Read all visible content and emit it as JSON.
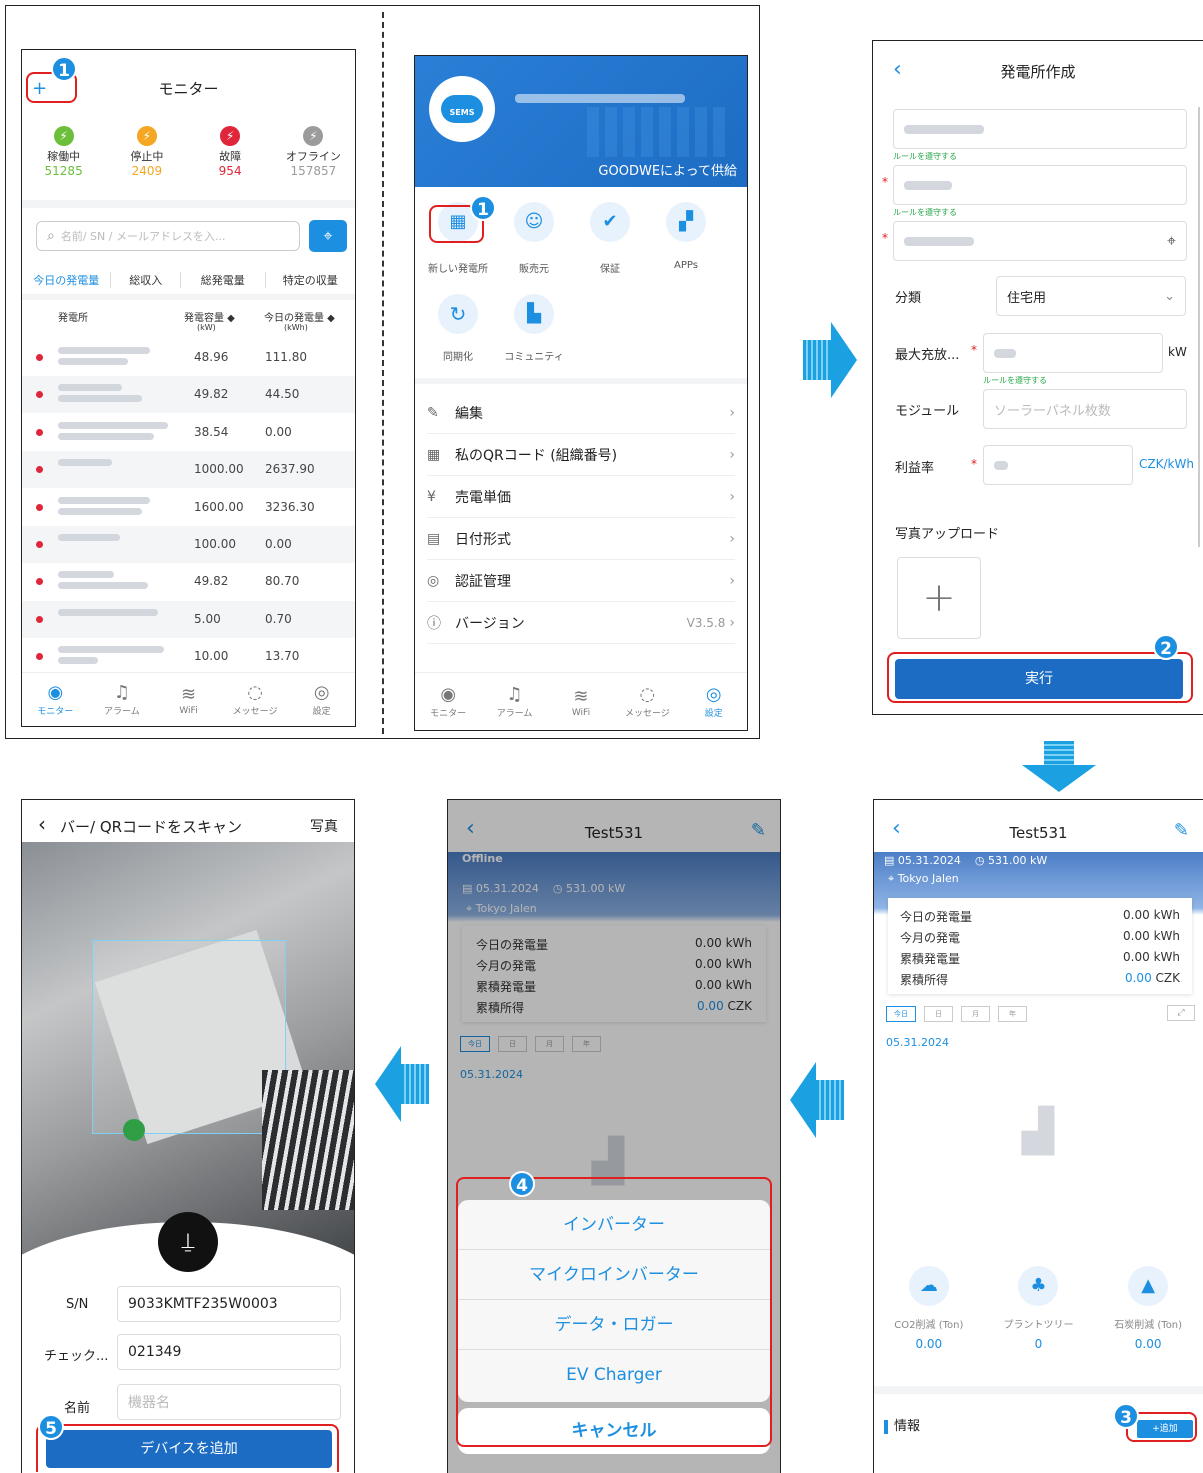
{
  "monitor": {
    "title": "モニター",
    "add": "+",
    "statuses": [
      {
        "label": "稼働中",
        "count": "51285",
        "color": "#6cbf3b"
      },
      {
        "label": "停止中",
        "count": "2409",
        "color": "#f5a623"
      },
      {
        "label": "故障",
        "count": "954",
        "color": "#e0263a"
      },
      {
        "label": "オフライン",
        "count": "157857",
        "color": "#9b9b9b"
      }
    ],
    "search_placeholder": "名前/ SN / メールアドレスを入...",
    "sort_tabs": [
      "今日の発電量",
      "総収入",
      "総発電量",
      "特定の収量"
    ],
    "col_station": "発電所",
    "col_capacity": "発電容量 ◆",
    "col_capacity_unit": "(kW)",
    "col_today": "今日の発電量 ◆",
    "col_today_unit": "(kWh)",
    "rows": [
      {
        "cap": "48.96",
        "today": "111.80"
      },
      {
        "cap": "49.82",
        "today": "44.50"
      },
      {
        "cap": "38.54",
        "today": "0.00"
      },
      {
        "cap": "1000.00",
        "today": "2637.90"
      },
      {
        "cap": "1600.00",
        "today": "3236.30"
      },
      {
        "cap": "100.00",
        "today": "0.00"
      },
      {
        "cap": "49.82",
        "today": "80.70"
      },
      {
        "cap": "5.00",
        "today": "0.70"
      },
      {
        "cap": "10.00",
        "today": "13.70"
      }
    ],
    "tabs": [
      "モニター",
      "アラーム",
      "WiFi",
      "メッセージ",
      "設定"
    ]
  },
  "settings": {
    "provided": "GOODWEによって供給",
    "logo": "SEMS",
    "icons": [
      "新しい発電所",
      "販売元",
      "保証",
      "APPs",
      "同期化",
      "コミュニティ"
    ],
    "menu": [
      {
        "icon": "✎",
        "label": "編集",
        "right": ""
      },
      {
        "icon": "▦",
        "label": "私のQRコード (組織番号)",
        "right": ""
      },
      {
        "icon": "¥",
        "label": "売電単価",
        "right": ""
      },
      {
        "icon": "▤",
        "label": "日付形式",
        "right": ""
      },
      {
        "icon": "◎",
        "label": "認証管理",
        "right": ""
      },
      {
        "icon": "ⓘ",
        "label": "バージョン",
        "right": "V3.5.8"
      }
    ],
    "tabs": [
      "モニター",
      "アラーム",
      "WiFi",
      "メッセージ",
      "設定"
    ]
  },
  "create": {
    "title": "発電所作成",
    "rule": "ルールを遵守する",
    "category_label": "分類",
    "category_value": "住宅用",
    "max_label": "最大充放...",
    "max_unit": "kW",
    "module_label": "モジュール",
    "module_placeholder": "ソーラーパネル枚数",
    "yield_label": "利益率",
    "yield_unit": "CZK/kWh",
    "photo_label": "写真アップロード",
    "submit": "実行"
  },
  "station": {
    "title": "Test531",
    "offline": "Offline",
    "date": "05.31.2024",
    "capacity": "531.00 kW",
    "location": "Tokyo Jalen",
    "stats": [
      {
        "label": "今日の発電量",
        "value": "0.00 kWh"
      },
      {
        "label": "今月の発電",
        "value": "0.00 kWh"
      },
      {
        "label": "累積発電量",
        "value": "0.00 kWh"
      },
      {
        "label": "累積所得",
        "value": "0.00",
        "unit": "CZK"
      }
    ],
    "periods": [
      "今日",
      "日",
      "月",
      "年"
    ],
    "chart_date": "05.31.2024",
    "env": [
      {
        "label": "CO2削減 (Ton)",
        "value": "0.00"
      },
      {
        "label": "プラントツリー",
        "value": "0"
      },
      {
        "label": "石炭削減 (Ton)",
        "value": "0.00"
      }
    ],
    "info": "情報",
    "add": "+追加"
  },
  "sheet": {
    "options": [
      "インバーター",
      "マイクロインバーター",
      "データ・ロガー",
      "EV Charger"
    ],
    "cancel": "キャンセル"
  },
  "scan": {
    "title": "バー/ QRコードをスキャン",
    "photo": "写真",
    "sn_label": "S/N",
    "sn_value": "9033KMTF235W0003",
    "check_label": "チェック...",
    "check_value": "021349",
    "name_label": "名前",
    "name_placeholder": "機器名",
    "add_button": "デバイスを追加"
  },
  "badges": [
    "1",
    "1",
    "2",
    "3",
    "4",
    "5"
  ]
}
